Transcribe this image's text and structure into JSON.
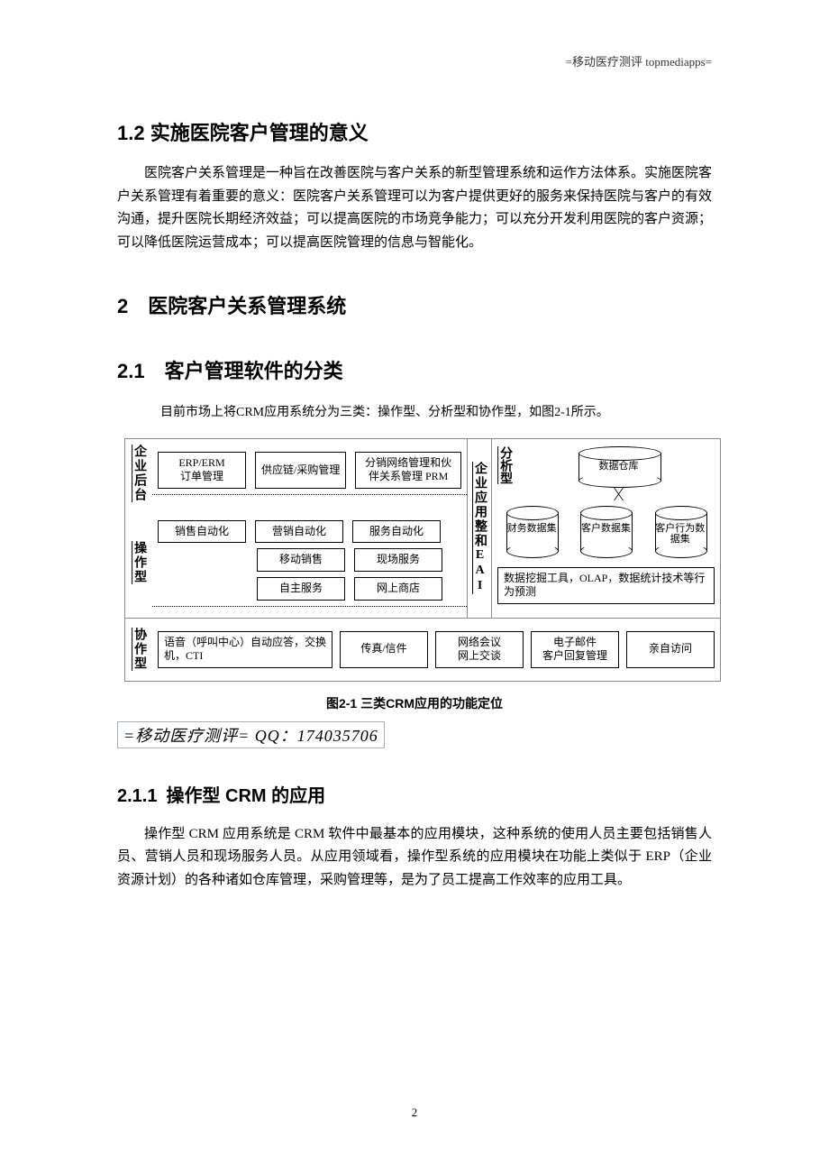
{
  "header": "=移动医疗测评 topmediapps=",
  "h_1_2": "1.2 实施医院客户管理的意义",
  "p_1_2": "医院客户关系管理是一种旨在改善医院与客户关系的新型管理系统和运作方法体系。实施医院客户关系管理有着重要的意义：医院客户关系管理可以为客户提供更好的服务来保持医院与客户的有效沟通，提升医院长期经济效益；可以提高医院的市场竞争能力；可以充分开发利用医院的客户资源；可以降低医院运营成本；可以提高医院管理的信息与智能化。",
  "h_2": "2 医院客户关系管理系统",
  "h_2_1": "2.1 客户管理软件的分类",
  "p_2_1_intro": "目前市场上将CRM应用系统分为三类：操作型、分析型和协作型，如图2-1所示。",
  "diagram": {
    "side_labels": {
      "back": "企业后台",
      "op": "操作型",
      "coop": "协作型",
      "eai": "企业应用整和EAI",
      "analytic": "分析型"
    },
    "back_row": [
      "ERP/ERM\n订单管理",
      "供应链/采购管理",
      "分销网络管理和伙伴关系管理 PRM"
    ],
    "op_row1": [
      "销售自动化",
      "营销自动化",
      "服务自动化"
    ],
    "op_row2": [
      "移动销售",
      "现场服务"
    ],
    "op_row3": [
      "自主服务",
      "网上商店"
    ],
    "coop_row": [
      "语音（呼叫中心）自动应答，交换机，CTI",
      "传真/信件",
      "网络会议\n网上交谈",
      "电子邮件\n客户回复管理",
      "亲自访问"
    ],
    "analytic": {
      "warehouse": "数据仓库",
      "sets": [
        "财务数据集",
        "客户数据集",
        "客户行为数据集"
      ],
      "tools": "数据挖掘工具，OLAP，数据统计技术等行为预测"
    }
  },
  "fig_caption": "图2-1  三类CRM应用的功能定位",
  "watermark": "=移动医疗测评= QQ：174035706",
  "h_2_1_1": "2.1.1 操作型 CRM 的应用",
  "p_2_1_1": "操作型 CRM 应用系统是 CRM 软件中最基本的应用模块，这种系统的使用人员主要包括销售人员、营销人员和现场服务人员。从应用领域看，操作型系统的应用模块在功能上类似于 ERP（企业资源计划）的各种诸如仓库管理，采购管理等，是为了员工提高工作效率的应用工具。",
  "page_number": "2"
}
